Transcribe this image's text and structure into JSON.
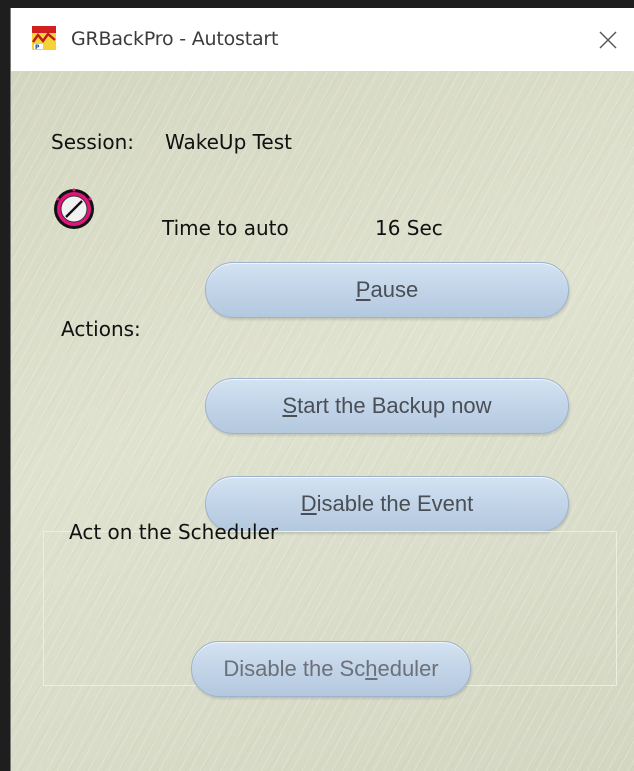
{
  "window": {
    "title": "GRBackPro - Autostart"
  },
  "session": {
    "label": "Session:",
    "name": "WakeUp Test"
  },
  "timer": {
    "label": "Time to auto",
    "value": "16 Sec"
  },
  "actions": {
    "label": "Actions:",
    "pause": {
      "underline_char": "P",
      "rest": "ause"
    },
    "start_backup": {
      "underline_char": "S",
      "rest": "tart the Backup now"
    },
    "disable_event": {
      "underline_char": "D",
      "rest": "isable the Event"
    }
  },
  "scheduler": {
    "group_label": "Act on the Scheduler",
    "disable_scheduler": {
      "before": "Disable the Sc",
      "underline_char": "h",
      "after": "eduler"
    }
  },
  "colors": {
    "background": "#d8dcc6",
    "button": "#c2d4e8",
    "timer_icon_ring": "#c8106a"
  },
  "icons": {
    "app": "grbackpro-app-icon",
    "close": "close-icon",
    "timer": "stopwatch-icon"
  }
}
